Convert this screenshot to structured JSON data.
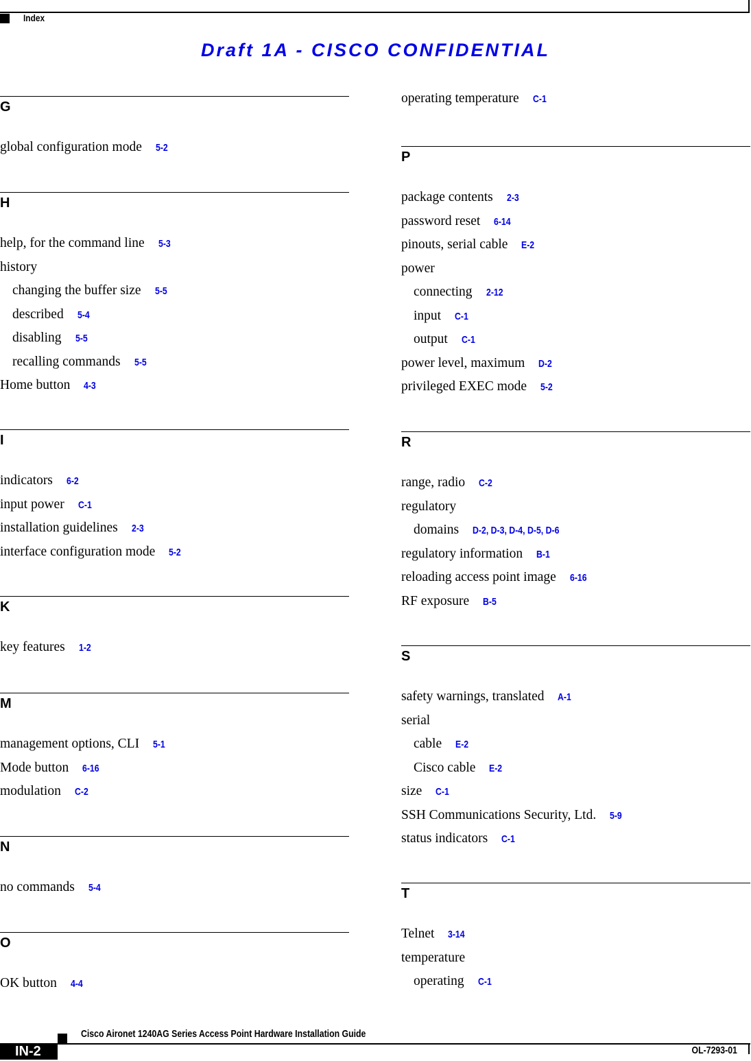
{
  "header": {
    "section": "Index",
    "watermark": "Draft 1A - CISCO CONFIDENTIAL"
  },
  "left": [
    {
      "letter": "G",
      "entries": [
        {
          "text": "global configuration mode",
          "ref": "5-2"
        }
      ]
    },
    {
      "letter": "H",
      "entries": [
        {
          "text": "help, for the command line",
          "ref": "5-3"
        },
        {
          "text": "history",
          "ref": ""
        },
        {
          "text": "changing the buffer size",
          "ref": "5-5",
          "sub": true
        },
        {
          "text": "described",
          "ref": "5-4",
          "sub": true
        },
        {
          "text": "disabling",
          "ref": "5-5",
          "sub": true
        },
        {
          "text": "recalling commands",
          "ref": "5-5",
          "sub": true
        },
        {
          "text": "Home button",
          "ref": "4-3"
        }
      ]
    },
    {
      "letter": "I",
      "entries": [
        {
          "text": "indicators",
          "ref": "6-2"
        },
        {
          "text": "input power",
          "ref": "C-1"
        },
        {
          "text": "installation guidelines",
          "ref": "2-3"
        },
        {
          "text": "interface configuration mode",
          "ref": "5-2"
        }
      ]
    },
    {
      "letter": "K",
      "entries": [
        {
          "text": "key features",
          "ref": "1-2"
        }
      ]
    },
    {
      "letter": "M",
      "entries": [
        {
          "text": "management options, CLI",
          "ref": "5-1"
        },
        {
          "text": "Mode button",
          "ref": "6-16"
        },
        {
          "text": "modulation",
          "ref": "C-2"
        }
      ]
    },
    {
      "letter": "N",
      "entries": [
        {
          "text": "no commands",
          "ref": "5-4"
        }
      ]
    },
    {
      "letter": "O",
      "entries": [
        {
          "text": "OK button",
          "ref": "4-4"
        }
      ]
    }
  ],
  "right": [
    {
      "letter": "",
      "entries": [
        {
          "text": "operating temperature",
          "ref": "C-1"
        }
      ]
    },
    {
      "letter": "P",
      "entries": [
        {
          "text": "package contents",
          "ref": "2-3"
        },
        {
          "text": "password reset",
          "ref": "6-14"
        },
        {
          "text": "pinouts, serial cable",
          "ref": "E-2"
        },
        {
          "text": "power",
          "ref": ""
        },
        {
          "text": "connecting",
          "ref": "2-12",
          "sub": true
        },
        {
          "text": "input",
          "ref": "C-1",
          "sub": true
        },
        {
          "text": "output",
          "ref": "C-1",
          "sub": true
        },
        {
          "text": "power level, maximum",
          "ref": "D-2"
        },
        {
          "text": "privileged EXEC mode",
          "ref": "5-2"
        }
      ]
    },
    {
      "letter": "R",
      "entries": [
        {
          "text": "range, radio",
          "ref": "C-2"
        },
        {
          "text": "regulatory",
          "ref": ""
        },
        {
          "text": "domains",
          "ref": "D-2, D-3, D-4, D-5, D-6",
          "sub": true
        },
        {
          "text": "regulatory information",
          "ref": "B-1"
        },
        {
          "text": "reloading access point image",
          "ref": "6-16"
        },
        {
          "text": "RF exposure",
          "ref": "B-5"
        }
      ]
    },
    {
      "letter": "S",
      "entries": [
        {
          "text": "safety warnings, translated",
          "ref": "A-1"
        },
        {
          "text": "serial",
          "ref": ""
        },
        {
          "text": "cable",
          "ref": "E-2",
          "sub": true
        },
        {
          "text": "Cisco cable",
          "ref": "E-2",
          "sub": true
        },
        {
          "text": "size",
          "ref": "C-1"
        },
        {
          "text": "SSH Communications Security, Ltd.",
          "ref": "5-9"
        },
        {
          "text": "status indicators",
          "ref": "C-1"
        }
      ]
    },
    {
      "letter": "T",
      "entries": [
        {
          "text": "Telnet",
          "ref": "3-14"
        },
        {
          "text": "temperature",
          "ref": ""
        },
        {
          "text": "operating",
          "ref": "C-1",
          "sub": true
        }
      ]
    }
  ],
  "footer": {
    "guide_title": "Cisco Aironet 1240AG Series Access Point Hardware Installation Guide",
    "page": "IN-2",
    "doc_number": "OL-7293-01"
  }
}
